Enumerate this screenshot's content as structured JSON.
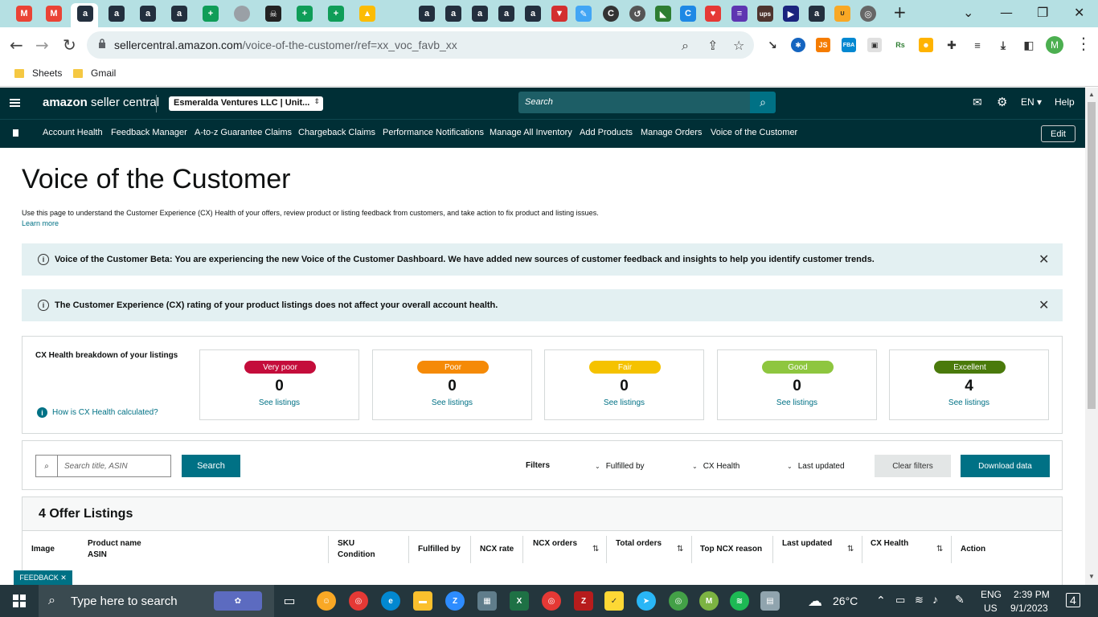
{
  "browser": {
    "url_main": "sellercentral.amazon.com",
    "url_path": "/voice-of-the-customer/ref=xx_voc_favb_xx",
    "profile_initial": "M",
    "bookmarks": [
      {
        "label": "Sheets"
      },
      {
        "label": "Gmail"
      }
    ]
  },
  "header": {
    "logo_bold": "amazon",
    "logo_rest": " seller central",
    "account": "Esmeralda Ventures LLC | Unit...",
    "search_placeholder": "Search",
    "lang": "EN",
    "help": "Help"
  },
  "nav": {
    "items": [
      "Account Health",
      "Feedback Manager",
      "A-to-z Guarantee Claims",
      "Chargeback Claims",
      "Performance Notifications",
      "Manage All Inventory",
      "Add Products",
      "Manage Orders",
      "Voice of the Customer"
    ],
    "edit": "Edit"
  },
  "page": {
    "title": "Voice of the Customer",
    "description": "Use this page to understand the Customer Experience (CX) Health of your offers, review product or listing feedback from customers, and take action to fix product and listing issues.",
    "learn_more": "Learn more"
  },
  "alerts": [
    "Voice of the Customer Beta: You are experiencing the new Voice of the Customer Dashboard. We have added new sources of customer feedback and insights to help you identify customer trends.",
    "The Customer Experience (CX) rating of your product listings does not affect your overall account health."
  ],
  "cx": {
    "label": "CX Health breakdown of your listings",
    "calc_link": "How is CX Health calculated?",
    "cards": [
      {
        "label": "Very poor",
        "count": "0",
        "color": "#c40d3b",
        "link": "See listings"
      },
      {
        "label": "Poor",
        "count": "0",
        "color": "#f58a07",
        "link": "See listings"
      },
      {
        "label": "Fair",
        "count": "0",
        "color": "#f5c200",
        "link": "See listings"
      },
      {
        "label": "Good",
        "count": "0",
        "color": "#8ec63f",
        "link": "See listings"
      },
      {
        "label": "Excellent",
        "count": "4",
        "color": "#4a7a0b",
        "link": "See listings"
      }
    ]
  },
  "filters": {
    "search_placeholder": "Search title, ASIN",
    "search_button": "Search",
    "label": "Filters",
    "dropdowns": [
      "Fulfilled by",
      "CX Health",
      "Last updated"
    ],
    "clear": "Clear filters",
    "download": "Download data"
  },
  "offers": {
    "title": "4 Offer Listings",
    "columns": {
      "image": "Image",
      "product_name": "Product name",
      "asin": "ASIN",
      "sku": "SKU",
      "condition": "Condition",
      "fulfilled_by": "Fulfilled by",
      "ncx_rate": "NCX rate",
      "ncx_orders": "NCX orders",
      "total_orders": "Total orders",
      "top_ncx_reason": "Top NCX reason",
      "last_updated": "Last updated",
      "cx_health": "CX Health",
      "action": "Action"
    }
  },
  "feedback": "FEEDBACK ✕",
  "taskbar": {
    "search_placeholder": "Type here to search",
    "weather": "26°C",
    "lang_top": "ENG",
    "lang_bottom": "US",
    "time": "2:39 PM",
    "date": "9/1/2023",
    "notifications": "4"
  },
  "colors": {
    "header_bg": "#002f36",
    "teal": "#007185",
    "alert_bg": "#e3f0f2"
  }
}
